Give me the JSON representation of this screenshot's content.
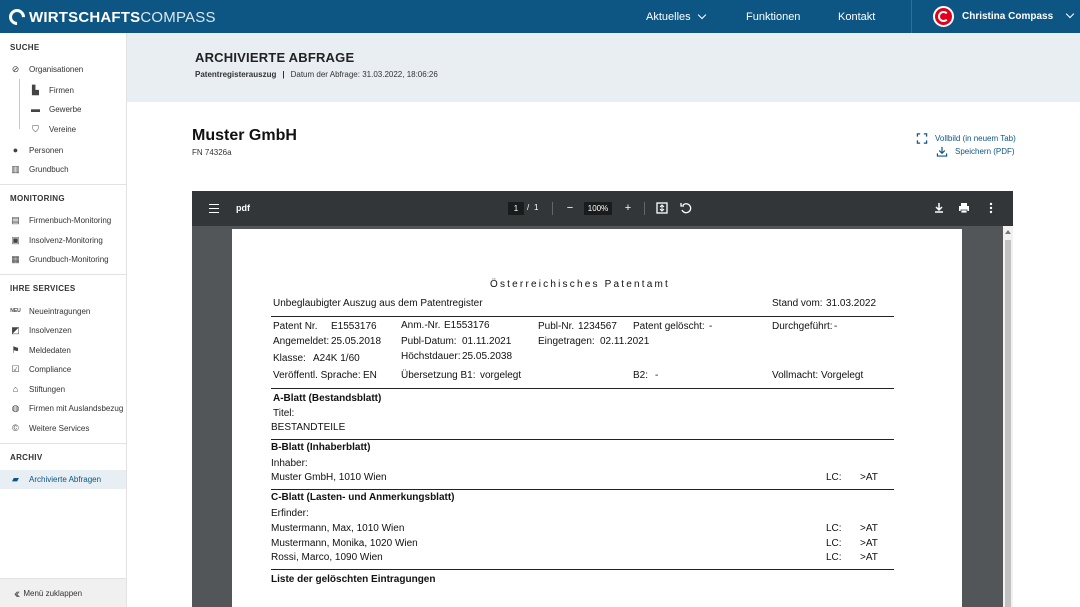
{
  "app": {
    "logo_bold": "WIRTSCHAFTS",
    "logo_light": "COMPASS",
    "nav": [
      "Aktuelles",
      "Funktionen",
      "Kontakt"
    ],
    "user_name": "Christina Compass"
  },
  "sidebar": {
    "sections": [
      {
        "title": "SUCHE"
      },
      {
        "title": "MONITORING"
      },
      {
        "title": "IHRE SERVICES"
      },
      {
        "title": "ARCHIV"
      }
    ],
    "items": [
      {
        "label": "Organisationen",
        "icon": "compass-icon"
      },
      {
        "label": "Firmen",
        "icon": "factory-icon"
      },
      {
        "label": "Gewerbe",
        "icon": "briefcase-icon"
      },
      {
        "label": "Vereine",
        "icon": "shield-icon"
      },
      {
        "label": "Personen",
        "icon": "person-icon"
      },
      {
        "label": "Grundbuch",
        "icon": "book-icon"
      },
      {
        "label": "Firmenbuch-Monitoring",
        "icon": "monitor-add-icon"
      },
      {
        "label": "Insolvenz-Monitoring",
        "icon": "person-add-icon"
      },
      {
        "label": "Grundbuch-Monitoring",
        "icon": "building-add-icon"
      },
      {
        "label": "Neueintragungen",
        "icon": "new-icon",
        "icon_text": "NEU"
      },
      {
        "label": "Insolvenzen",
        "icon": "chart-icon"
      },
      {
        "label": "Meldedaten",
        "icon": "flag-icon"
      },
      {
        "label": "Compliance",
        "icon": "checkbox-icon"
      },
      {
        "label": "Stiftungen",
        "icon": "bank-icon"
      },
      {
        "label": "Firmen mit Auslandsbezug",
        "icon": "globe-icon"
      },
      {
        "label": "Weitere Services",
        "icon": "copyright-icon"
      },
      {
        "label": "Archivierte Abfragen",
        "icon": "archive-icon"
      }
    ],
    "collapse_label": "Menü zuklappen"
  },
  "header": {
    "title": "ARCHIVIERTE ABFRAGE",
    "type": "Patentregisterauszug",
    "separator": "|",
    "date": "Datum der Abfrage: 31.03.2022, 18:06:26"
  },
  "company": {
    "name": "Muster GmbH",
    "fn": "FN 74326a",
    "fullscreen_label": "Vollbild (in neuem Tab)",
    "save_label": "Speichern (PDF)"
  },
  "pdf": {
    "title": "pdf",
    "page_current": "1",
    "page_sep": "/",
    "page_total": "1",
    "zoom": "100%"
  },
  "doc": {
    "heading": "Österreichisches Patentamt",
    "subtitle": "Unbeglaubigter Auszug aus dem Patentregister",
    "stand_label": "Stand vom:",
    "stand_value": "31.03.2022",
    "patent_nr_label": "Patent Nr.",
    "patent_nr": "E1553176",
    "anm_label": "Anm.-Nr.",
    "anm_value": "E1553176",
    "publ_nr_label": "Publ-Nr.",
    "publ_nr": "1234567",
    "geloescht_label": "Patent gelöscht:",
    "geloescht_value": "-",
    "durchgefuehrt_label": "Durchgeführt:",
    "durchgefuehrt_value": "-",
    "angemeldet_label": "Angemeldet:",
    "angemeldet_value": "25.05.2018",
    "publ_datum_label": "Publ-Datum:",
    "publ_datum_value": "01.11.2021",
    "eingetragen_label": "Eingetragen:",
    "eingetragen_value": "02.11.2021",
    "klasse_label": "Klasse:",
    "klasse_value": "A24K 1/60",
    "hoechst_label": "Höchstdauer:",
    "hoechst_value": "25.05.2038",
    "sprache_label": "Veröffentl. Sprache:",
    "sprache_value": "EN",
    "uebersetzung_label": "Übersetzung B1:",
    "uebersetzung_value": "vorgelegt",
    "b2_label": "B2:",
    "b2_value": "-",
    "vollmacht_label": "Vollmacht:",
    "vollmacht_value": "Vorgelegt",
    "a_blatt": "A-Blatt (Bestandsblatt)",
    "titel_label": "Titel:",
    "titel_value": "BESTANDTEILE",
    "b_blatt": "B-Blatt (Inhaberblatt)",
    "inhaber_label": "Inhaber:",
    "inhaber_value": "Muster GmbH, 1010 Wien",
    "lc_label": "LC:",
    "lc_value": ">AT",
    "c_blatt": "C-Blatt (Lasten- und Anmerkungsblatt)",
    "erfinder_label": "Erfinder:",
    "erfinder": [
      {
        "name": "Mustermann, Max, 1010 Wien",
        "lc_label": "LC:",
        "lc": ">AT"
      },
      {
        "name": "Mustermann, Monika, 1020 Wien",
        "lc_label": "LC:",
        "lc": ">AT"
      },
      {
        "name": "Rossi, Marco, 1090 Wien",
        "lc_label": "LC:",
        "lc": ">AT"
      }
    ],
    "geloeschte_heading": "Liste der gelöschten Eintragungen"
  }
}
